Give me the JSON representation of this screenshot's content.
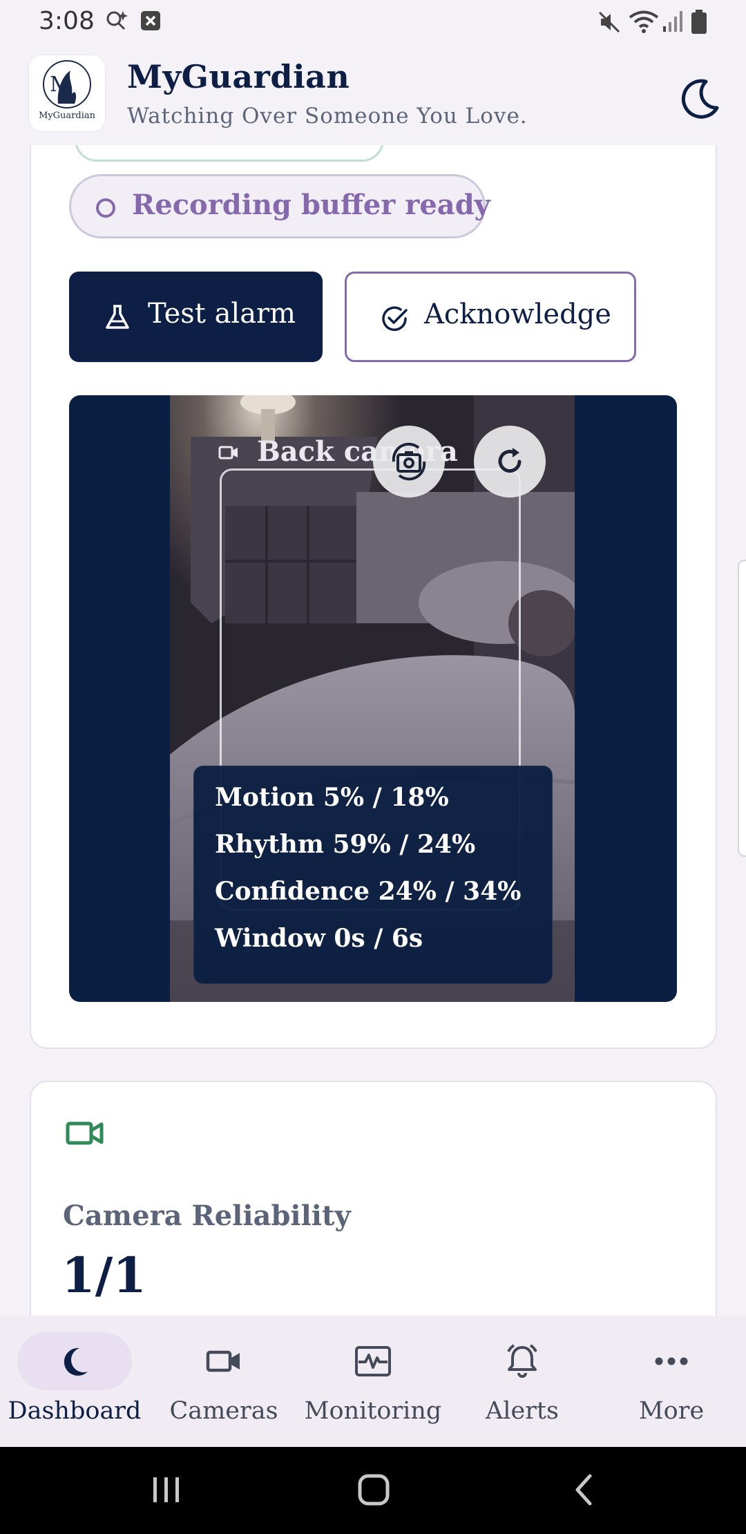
{
  "status_bar": {
    "time": "3:08"
  },
  "app_bar": {
    "title": "MyGuardian",
    "subtitle": "Watching Over Someone You Love.",
    "logo_text": "MyGuardian"
  },
  "monitor_card": {
    "recording_status": "Recording buffer ready",
    "test_alarm_label": "Test alarm",
    "acknowledge_label": "Acknowledge",
    "camera": {
      "label": "Back camera",
      "metrics": {
        "motion": "Motion 5% / 18%",
        "rhythm": "Rhythm 59% / 24%",
        "confidence": "Confidence 24% / 34%",
        "window": "Window 0s / 6s"
      }
    }
  },
  "reliability_card": {
    "title": "Camera Reliability",
    "value": "1/1",
    "icon": "video-camera-icon",
    "icon_color": "#2e8b57"
  },
  "bottom_nav": {
    "items": [
      {
        "label": "Dashboard",
        "icon": "moon-icon",
        "active": true
      },
      {
        "label": "Cameras",
        "icon": "video-camera-icon",
        "active": false
      },
      {
        "label": "Monitoring",
        "icon": "heartbeat-icon",
        "active": false
      },
      {
        "label": "Alerts",
        "icon": "bell-icon",
        "active": false
      },
      {
        "label": "More",
        "icon": "more-icon",
        "active": false
      }
    ]
  },
  "colors": {
    "primary": "#0d1f45",
    "accent": "#8669ac",
    "background": "#f4f2f7",
    "nav_background": "#f1ecf4"
  }
}
